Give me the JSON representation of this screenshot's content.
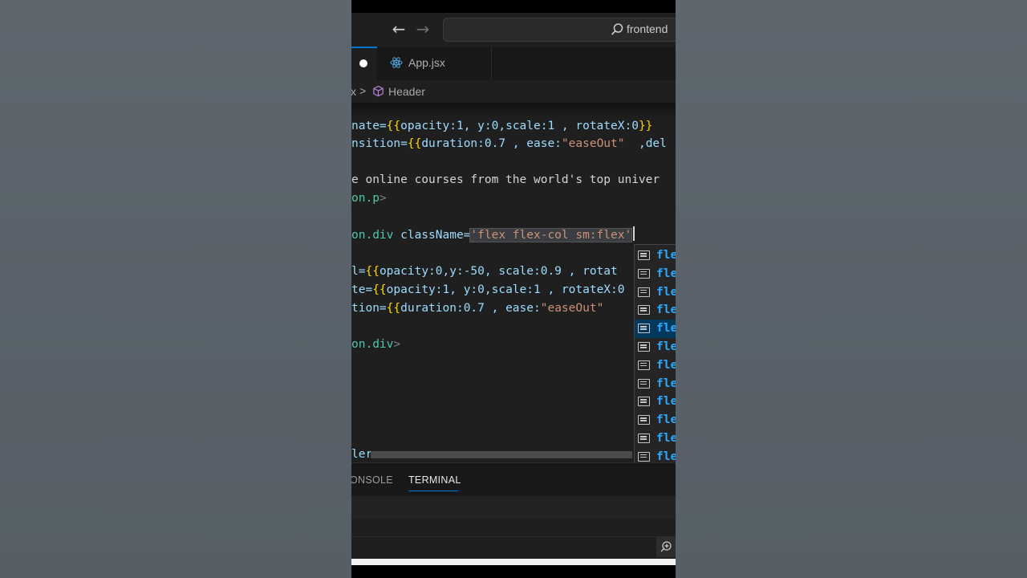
{
  "titlebar": {
    "search_text": "frontend"
  },
  "tabs": [
    {
      "label": "App.jsx",
      "active": false
    }
  ],
  "breadcrumb": {
    "fragment": "x",
    "separator": ">",
    "symbol": "Header"
  },
  "editor": {
    "lines": {
      "l1_attr": "nate=",
      "l1_open": "{{",
      "l1_body": "opacity:1, y:0,scale:1 , rotateX:0",
      "l1_close": "}}",
      "l2_attr": "nsition=",
      "l2_open": "{{",
      "l2_body": "duration:0.7 , ease:",
      "l2_str": "\"easeOut\"",
      "l2_rest": "  ,del",
      "l3_text": "e online courses from the world's top univer",
      "l4_tag": "on.p",
      "l4_close": ">",
      "l5_tag": "on.div ",
      "l5_attr": "className=",
      "l5_str": "'flex flex-col sm:flex'",
      "l6_attr": "l=",
      "l6_open": "{{",
      "l6_body": "opacity:0,y:-50, scale:0.9 , rotat",
      "l7_attr": "te=",
      "l7_open": "{{",
      "l7_body": "opacity:1, y:0,scale:1 , rotateX:0",
      "l8_attr": "tion=",
      "l8_open": "{{",
      "l8_body": "duration:0.7 , ease:",
      "l8_str": "\"easeOut\"",
      "l9_tag": "on.div",
      "l9_close": ">",
      "footer": "ler"
    },
    "suggestions": [
      "fle",
      "fle",
      "fle",
      "fle",
      "fle",
      "fle",
      "fle",
      "fle",
      "fle",
      "fle",
      "fle",
      "fle"
    ],
    "selected_suggestion_index": 4
  },
  "panel": {
    "tab_console": "ONSOLE",
    "tab_terminal": "TERMINAL"
  },
  "colors": {
    "accent": "#0078d4",
    "suggest_text": "#2aaaff",
    "string": "#ce9178",
    "attr": "#9cdcfe"
  }
}
